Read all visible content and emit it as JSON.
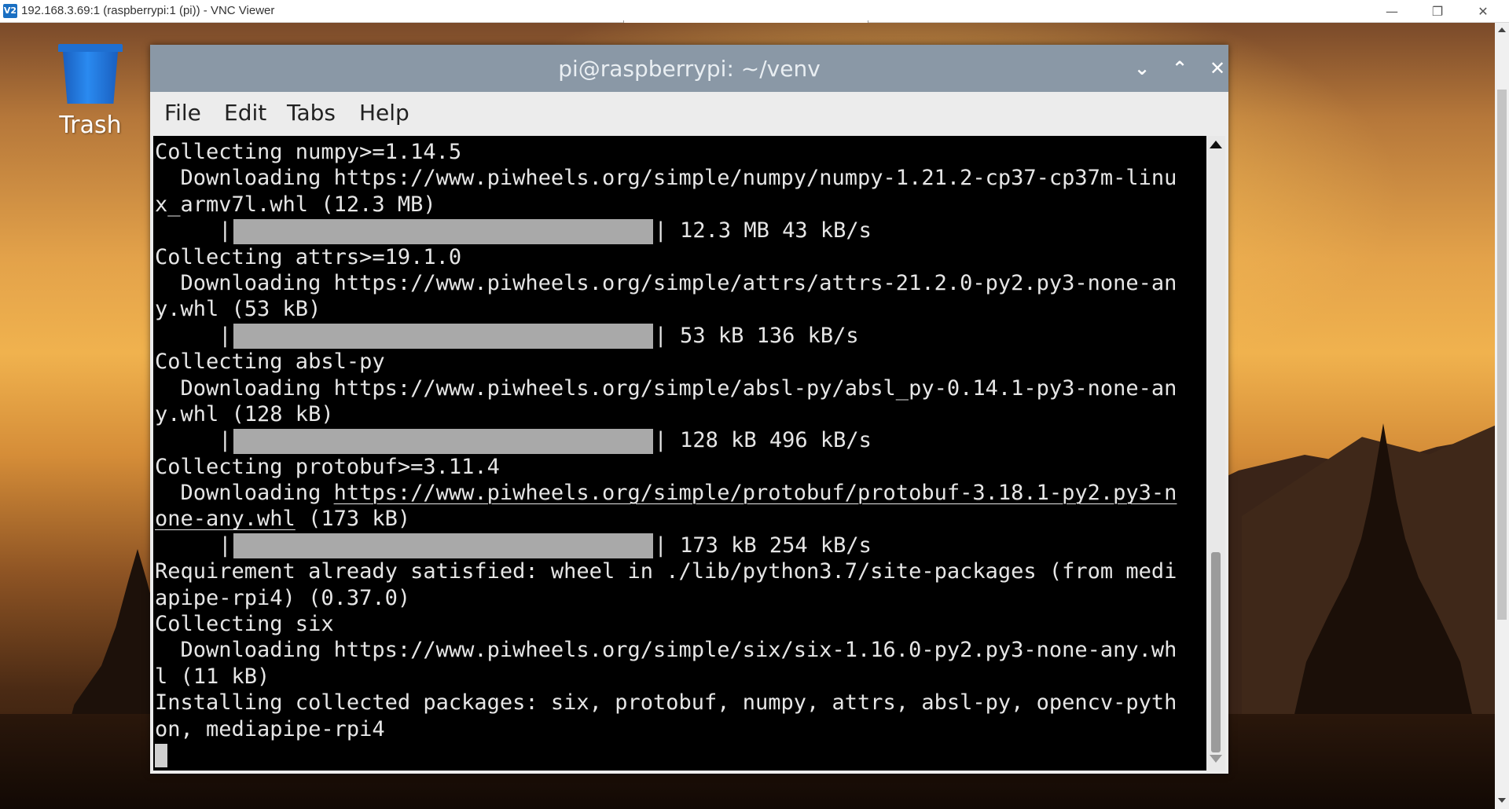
{
  "vnc": {
    "logo_text": "V2",
    "title": "192.168.3.69:1 (raspberrypi:1 (pi)) - VNC Viewer",
    "controls": {
      "minimize": "—",
      "restore": "❐",
      "close": "✕"
    }
  },
  "desktop": {
    "trash_label": "Trash"
  },
  "terminal": {
    "title": "pi@raspberrypi: ~/venv",
    "buttons": {
      "minimize": "⌄",
      "maximize": "⌃",
      "close": "✕"
    },
    "menu": [
      "File",
      "Edit",
      "Tabs",
      "Help"
    ],
    "lines": [
      {
        "text": "Collecting numpy>=1.14.5"
      },
      {
        "text": "  Downloading https://www.piwheels.org/simple/numpy/numpy-1.21.2-cp37-cp37m-linu"
      },
      {
        "text": "x_armv7l.whl (12.3 MB)"
      },
      {
        "progress_prefix": "     |",
        "progress_suffix": "| 12.3 MB 43 kB/s",
        "fill": 1.0
      },
      {
        "text": "Collecting attrs>=19.1.0"
      },
      {
        "text": "  Downloading https://www.piwheels.org/simple/attrs/attrs-21.2.0-py2.py3-none-an"
      },
      {
        "text": "y.whl (53 kB)"
      },
      {
        "progress_prefix": "     |",
        "progress_suffix": "| 53 kB 136 kB/s",
        "fill": 1.0
      },
      {
        "text": "Collecting absl-py"
      },
      {
        "text": "  Downloading https://www.piwheels.org/simple/absl-py/absl_py-0.14.1-py3-none-an"
      },
      {
        "text": "y.whl (128 kB)"
      },
      {
        "progress_prefix": "     |",
        "progress_suffix": "| 128 kB 496 kB/s",
        "fill": 1.0
      },
      {
        "text": "Collecting protobuf>=3.11.4"
      },
      {
        "text_pre": "  Downloading ",
        "link": "https://www.piwheels.org/simple/protobuf/protobuf-3.18.1-py2.py3-n"
      },
      {
        "link": "one-any.whl",
        "text_post": " (173 kB)"
      },
      {
        "progress_prefix": "     |",
        "progress_suffix": "| 173 kB 254 kB/s",
        "fill": 1.0
      },
      {
        "text": "Requirement already satisfied: wheel in ./lib/python3.7/site-packages (from medi"
      },
      {
        "text": "apipe-rpi4) (0.37.0)"
      },
      {
        "text": "Collecting six"
      },
      {
        "text": "  Downloading https://www.piwheels.org/simple/six/six-1.16.0-py2.py3-none-any.wh"
      },
      {
        "text": "l (11 kB)"
      },
      {
        "text": "Installing collected packages: six, protobuf, numpy, attrs, absl-py, opencv-pyth"
      },
      {
        "text": "on, mediapipe-rpi4"
      },
      {
        "cursor": true
      }
    ]
  }
}
